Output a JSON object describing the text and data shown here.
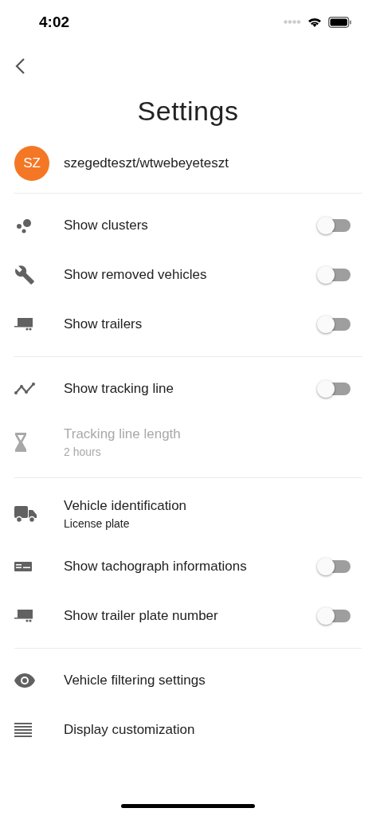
{
  "status_bar": {
    "time": "4:02"
  },
  "title": "Settings",
  "account": {
    "initials": "SZ",
    "name": "szegedteszt/wtwebeyeteszt"
  },
  "sections": [
    {
      "rows": [
        {
          "kind": "toggle",
          "label": "Show clusters",
          "on": false
        },
        {
          "kind": "toggle",
          "label": "Show removed vehicles",
          "on": false
        },
        {
          "kind": "toggle",
          "label": "Show trailers",
          "on": false
        }
      ]
    },
    {
      "rows": [
        {
          "kind": "toggle",
          "label": "Show tracking line",
          "on": false
        },
        {
          "kind": "value",
          "label": "Tracking line length",
          "value": "2 hours",
          "disabled": true
        }
      ]
    },
    {
      "rows": [
        {
          "kind": "value",
          "label": "Vehicle identification",
          "value": "License plate",
          "disabled": false
        },
        {
          "kind": "toggle",
          "label": "Show tachograph informations",
          "on": false
        },
        {
          "kind": "toggle",
          "label": "Show trailer plate number",
          "on": false
        }
      ]
    },
    {
      "rows": [
        {
          "kind": "link",
          "label": "Vehicle filtering settings"
        },
        {
          "kind": "link",
          "label": "Display customization"
        }
      ]
    }
  ]
}
